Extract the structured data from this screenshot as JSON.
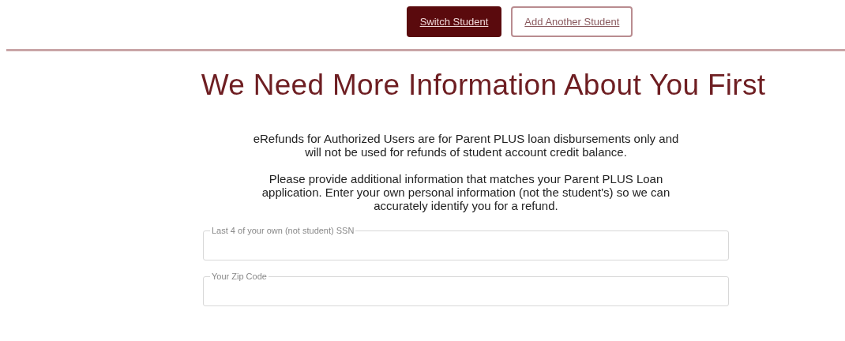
{
  "buttons": [
    {
      "label": "Switch Student",
      "kind": "primary"
    },
    {
      "label": "Add Another Student",
      "kind": "secondary"
    }
  ],
  "heading": "We Need More Information About You First",
  "paragraphs": [
    "eRefunds for Authorized Users are for Parent PLUS loan disbursements only and will not be used for refunds of student account credit balance.",
    "Please provide additional information that matches your Parent PLUS Loan application. Enter your own personal information (not the student's) so we can accurately identify you for a refund."
  ],
  "fields": [
    {
      "placeholder": "Last 4 of your own (not student) SSN"
    },
    {
      "placeholder": "Your Zip Code"
    }
  ]
}
